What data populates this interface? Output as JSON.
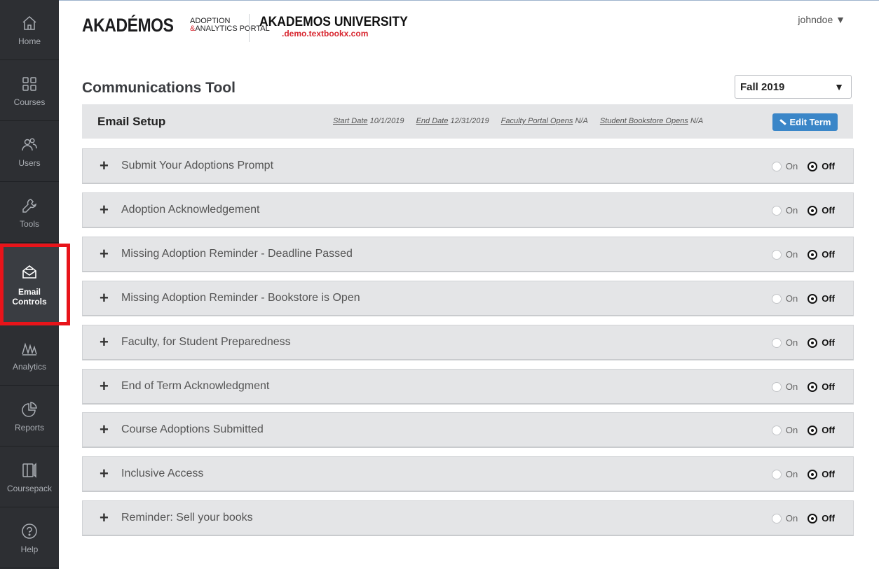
{
  "sidebar": {
    "items": [
      {
        "label": "Home",
        "icon": "home-icon"
      },
      {
        "label": "Courses",
        "icon": "grid-icon"
      },
      {
        "label": "Users",
        "icon": "users-icon"
      },
      {
        "label": "Tools",
        "icon": "wrench-icon"
      },
      {
        "label": "Email Controls",
        "icon": "envelope-icon",
        "active": true
      },
      {
        "label": "Analytics",
        "icon": "analytics-icon"
      },
      {
        "label": "Reports",
        "icon": "pie-chart-icon"
      },
      {
        "label": "Coursepack",
        "icon": "book-icon"
      },
      {
        "label": "Help",
        "icon": "help-icon"
      }
    ]
  },
  "header": {
    "logo_main": "AKADÉMOS",
    "logo_sub_line1": "ADOPTION",
    "logo_sub_amp": "&",
    "logo_sub_line2": "ANALYTICS PORTAL",
    "university_name": "AKADEMOS UNIVERSITY",
    "university_domain": ".demo.textbookx.com",
    "user": "johndoe ▼"
  },
  "page": {
    "title": "Communications Tool",
    "term": "Fall 2019",
    "term_caret": "▼"
  },
  "setup": {
    "title": "Email Setup",
    "start_label": "Start Date",
    "start_value": "10/1/2019",
    "end_label": "End Date",
    "end_value": "12/31/2019",
    "faculty_label": "Faculty Portal Opens",
    "faculty_value": "N/A",
    "bookstore_label": "Student Bookstore Opens",
    "bookstore_value": "N/A",
    "edit_button": "Edit Term"
  },
  "toggle_labels": {
    "on": "On",
    "off": "Off"
  },
  "emails": [
    {
      "name": "Submit Your Adoptions Prompt",
      "state": "off"
    },
    {
      "name": "Adoption Acknowledgement",
      "state": "off"
    },
    {
      "name": "Missing Adoption Reminder - Deadline Passed",
      "state": "off"
    },
    {
      "name": "Missing Adoption Reminder - Bookstore is Open",
      "state": "off"
    },
    {
      "name": "Faculty, for Student Preparedness",
      "state": "off"
    },
    {
      "name": "End of Term Acknowledgment",
      "state": "off"
    },
    {
      "name": "Course Adoptions Submitted",
      "state": "off"
    },
    {
      "name": "Inclusive Access",
      "state": "off"
    },
    {
      "name": "Reminder: Sell your books",
      "state": "off"
    }
  ],
  "colors": {
    "sidebar_bg": "#2d2f33",
    "accent_blue": "#3a86c8",
    "highlight_red": "#e8141a",
    "brand_red": "#d8262f"
  }
}
